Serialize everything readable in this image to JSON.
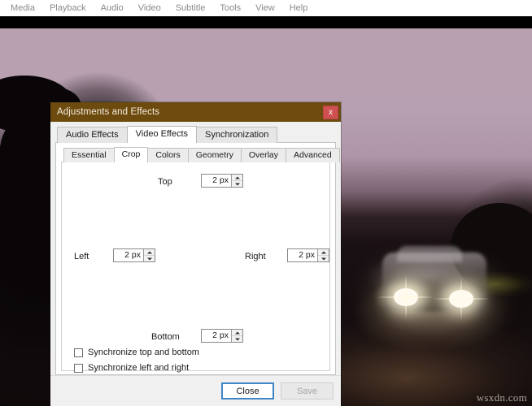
{
  "menubar": {
    "items": [
      {
        "label": "Media"
      },
      {
        "label": "Playback"
      },
      {
        "label": "Audio"
      },
      {
        "label": "Video"
      },
      {
        "label": "Subtitle"
      },
      {
        "label": "Tools"
      },
      {
        "label": "View"
      },
      {
        "label": "Help"
      }
    ]
  },
  "video": {
    "watermark": "wsxdn.com"
  },
  "dialog": {
    "title": "Adjustments and Effects",
    "close_label": "x",
    "top_tabs": [
      {
        "label": "Audio Effects",
        "active": false
      },
      {
        "label": "Video Effects",
        "active": true
      },
      {
        "label": "Synchronization",
        "active": false
      }
    ],
    "sub_tabs": [
      {
        "label": "Essential",
        "active": false
      },
      {
        "label": "Crop",
        "active": true
      },
      {
        "label": "Colors",
        "active": false
      },
      {
        "label": "Geometry",
        "active": false
      },
      {
        "label": "Overlay",
        "active": false
      },
      {
        "label": "Advanced",
        "active": false
      }
    ],
    "crop": {
      "top": {
        "label": "Top",
        "value": "2 px"
      },
      "left": {
        "label": "Left",
        "value": "2 px"
      },
      "right": {
        "label": "Right",
        "value": "2 px"
      },
      "bottom": {
        "label": "Bottom",
        "value": "2 px"
      },
      "sync_top_bottom": {
        "label": "Synchronize top and bottom",
        "checked": false
      },
      "sync_left_right": {
        "label": "Synchronize left and right",
        "checked": false
      }
    },
    "footer": {
      "close_label": "Close",
      "save_label": "Save"
    }
  },
  "colors": {
    "titlebar": "#6d4b0e",
    "close_button": "#cf5050",
    "focus_outline": "#3f85c6",
    "dialog_bg": "#f0f0f0",
    "panel_bg": "#ffffff",
    "sky": "#b9a0b0"
  }
}
